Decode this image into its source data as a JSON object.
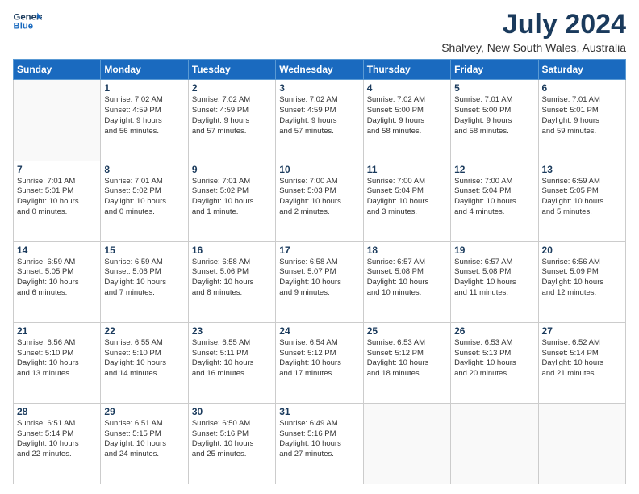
{
  "header": {
    "logo_line1": "General",
    "logo_line2": "Blue",
    "month_year": "July 2024",
    "location": "Shalvey, New South Wales, Australia"
  },
  "weekdays": [
    "Sunday",
    "Monday",
    "Tuesday",
    "Wednesday",
    "Thursday",
    "Friday",
    "Saturday"
  ],
  "weeks": [
    [
      {
        "day": "",
        "lines": []
      },
      {
        "day": "1",
        "lines": [
          "Sunrise: 7:02 AM",
          "Sunset: 4:59 PM",
          "Daylight: 9 hours",
          "and 56 minutes."
        ]
      },
      {
        "day": "2",
        "lines": [
          "Sunrise: 7:02 AM",
          "Sunset: 4:59 PM",
          "Daylight: 9 hours",
          "and 57 minutes."
        ]
      },
      {
        "day": "3",
        "lines": [
          "Sunrise: 7:02 AM",
          "Sunset: 4:59 PM",
          "Daylight: 9 hours",
          "and 57 minutes."
        ]
      },
      {
        "day": "4",
        "lines": [
          "Sunrise: 7:02 AM",
          "Sunset: 5:00 PM",
          "Daylight: 9 hours",
          "and 58 minutes."
        ]
      },
      {
        "day": "5",
        "lines": [
          "Sunrise: 7:01 AM",
          "Sunset: 5:00 PM",
          "Daylight: 9 hours",
          "and 58 minutes."
        ]
      },
      {
        "day": "6",
        "lines": [
          "Sunrise: 7:01 AM",
          "Sunset: 5:01 PM",
          "Daylight: 9 hours",
          "and 59 minutes."
        ]
      }
    ],
    [
      {
        "day": "7",
        "lines": [
          "Sunrise: 7:01 AM",
          "Sunset: 5:01 PM",
          "Daylight: 10 hours",
          "and 0 minutes."
        ]
      },
      {
        "day": "8",
        "lines": [
          "Sunrise: 7:01 AM",
          "Sunset: 5:02 PM",
          "Daylight: 10 hours",
          "and 0 minutes."
        ]
      },
      {
        "day": "9",
        "lines": [
          "Sunrise: 7:01 AM",
          "Sunset: 5:02 PM",
          "Daylight: 10 hours",
          "and 1 minute."
        ]
      },
      {
        "day": "10",
        "lines": [
          "Sunrise: 7:00 AM",
          "Sunset: 5:03 PM",
          "Daylight: 10 hours",
          "and 2 minutes."
        ]
      },
      {
        "day": "11",
        "lines": [
          "Sunrise: 7:00 AM",
          "Sunset: 5:04 PM",
          "Daylight: 10 hours",
          "and 3 minutes."
        ]
      },
      {
        "day": "12",
        "lines": [
          "Sunrise: 7:00 AM",
          "Sunset: 5:04 PM",
          "Daylight: 10 hours",
          "and 4 minutes."
        ]
      },
      {
        "day": "13",
        "lines": [
          "Sunrise: 6:59 AM",
          "Sunset: 5:05 PM",
          "Daylight: 10 hours",
          "and 5 minutes."
        ]
      }
    ],
    [
      {
        "day": "14",
        "lines": [
          "Sunrise: 6:59 AM",
          "Sunset: 5:05 PM",
          "Daylight: 10 hours",
          "and 6 minutes."
        ]
      },
      {
        "day": "15",
        "lines": [
          "Sunrise: 6:59 AM",
          "Sunset: 5:06 PM",
          "Daylight: 10 hours",
          "and 7 minutes."
        ]
      },
      {
        "day": "16",
        "lines": [
          "Sunrise: 6:58 AM",
          "Sunset: 5:06 PM",
          "Daylight: 10 hours",
          "and 8 minutes."
        ]
      },
      {
        "day": "17",
        "lines": [
          "Sunrise: 6:58 AM",
          "Sunset: 5:07 PM",
          "Daylight: 10 hours",
          "and 9 minutes."
        ]
      },
      {
        "day": "18",
        "lines": [
          "Sunrise: 6:57 AM",
          "Sunset: 5:08 PM",
          "Daylight: 10 hours",
          "and 10 minutes."
        ]
      },
      {
        "day": "19",
        "lines": [
          "Sunrise: 6:57 AM",
          "Sunset: 5:08 PM",
          "Daylight: 10 hours",
          "and 11 minutes."
        ]
      },
      {
        "day": "20",
        "lines": [
          "Sunrise: 6:56 AM",
          "Sunset: 5:09 PM",
          "Daylight: 10 hours",
          "and 12 minutes."
        ]
      }
    ],
    [
      {
        "day": "21",
        "lines": [
          "Sunrise: 6:56 AM",
          "Sunset: 5:10 PM",
          "Daylight: 10 hours",
          "and 13 minutes."
        ]
      },
      {
        "day": "22",
        "lines": [
          "Sunrise: 6:55 AM",
          "Sunset: 5:10 PM",
          "Daylight: 10 hours",
          "and 14 minutes."
        ]
      },
      {
        "day": "23",
        "lines": [
          "Sunrise: 6:55 AM",
          "Sunset: 5:11 PM",
          "Daylight: 10 hours",
          "and 16 minutes."
        ]
      },
      {
        "day": "24",
        "lines": [
          "Sunrise: 6:54 AM",
          "Sunset: 5:12 PM",
          "Daylight: 10 hours",
          "and 17 minutes."
        ]
      },
      {
        "day": "25",
        "lines": [
          "Sunrise: 6:53 AM",
          "Sunset: 5:12 PM",
          "Daylight: 10 hours",
          "and 18 minutes."
        ]
      },
      {
        "day": "26",
        "lines": [
          "Sunrise: 6:53 AM",
          "Sunset: 5:13 PM",
          "Daylight: 10 hours",
          "and 20 minutes."
        ]
      },
      {
        "day": "27",
        "lines": [
          "Sunrise: 6:52 AM",
          "Sunset: 5:14 PM",
          "Daylight: 10 hours",
          "and 21 minutes."
        ]
      }
    ],
    [
      {
        "day": "28",
        "lines": [
          "Sunrise: 6:51 AM",
          "Sunset: 5:14 PM",
          "Daylight: 10 hours",
          "and 22 minutes."
        ]
      },
      {
        "day": "29",
        "lines": [
          "Sunrise: 6:51 AM",
          "Sunset: 5:15 PM",
          "Daylight: 10 hours",
          "and 24 minutes."
        ]
      },
      {
        "day": "30",
        "lines": [
          "Sunrise: 6:50 AM",
          "Sunset: 5:16 PM",
          "Daylight: 10 hours",
          "and 25 minutes."
        ]
      },
      {
        "day": "31",
        "lines": [
          "Sunrise: 6:49 AM",
          "Sunset: 5:16 PM",
          "Daylight: 10 hours",
          "and 27 minutes."
        ]
      },
      {
        "day": "",
        "lines": []
      },
      {
        "day": "",
        "lines": []
      },
      {
        "day": "",
        "lines": []
      }
    ]
  ]
}
